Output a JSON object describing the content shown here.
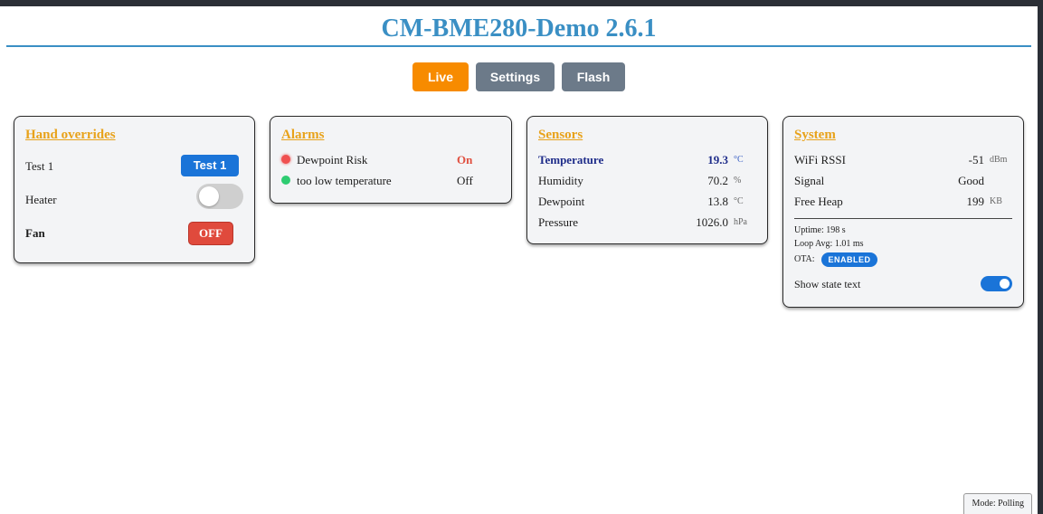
{
  "app": {
    "title": "CM-BME280-Demo 2.6.1"
  },
  "nav": {
    "live": "Live",
    "settings": "Settings",
    "flash": "Flash"
  },
  "overrides": {
    "title": "Hand overrides",
    "test1_label": "Test 1",
    "test1_button": "Test 1",
    "heater_label": "Heater",
    "heater_state": "off",
    "fan_label": "Fan",
    "fan_button": "OFF"
  },
  "alarms": {
    "title": "Alarms",
    "items": [
      {
        "label": "Dewpoint Risk",
        "state": "On",
        "color": "#e05040"
      },
      {
        "label": "too low temperature",
        "state": "Off",
        "color": "#2ecc71"
      }
    ]
  },
  "sensors": {
    "title": "Sensors",
    "items": [
      {
        "label": "Temperature",
        "value": "19.3",
        "unit": "°C"
      },
      {
        "label": "Humidity",
        "value": "70.2",
        "unit": "%"
      },
      {
        "label": "Dewpoint",
        "value": "13.8",
        "unit": "°C"
      },
      {
        "label": "Pressure",
        "value": "1026.0",
        "unit": "hPa"
      }
    ]
  },
  "system": {
    "title": "System",
    "items": [
      {
        "label": "WiFi RSSI",
        "value": "-51",
        "unit": "dBm"
      },
      {
        "label": "Signal",
        "value": "Good",
        "unit": ""
      },
      {
        "label": "Free Heap",
        "value": "199",
        "unit": "KB"
      }
    ],
    "uptime": "Uptime: 198 s",
    "loop_avg": "Loop Avg: 1.01 ms",
    "ota_label": "OTA:",
    "ota_badge": "ENABLED",
    "show_state_label": "Show state text",
    "show_state_on": true
  },
  "footer": {
    "mode": "Mode: Polling"
  },
  "colors": {
    "accent": "#3a8fc4",
    "live": "#f78b00",
    "nav_inactive": "#6c7a89",
    "primary": "#1a74d8",
    "danger": "#e04a3c",
    "section_title": "#e8a21a"
  }
}
